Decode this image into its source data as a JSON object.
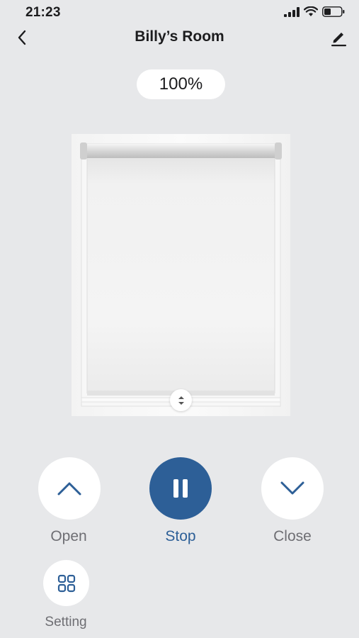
{
  "status_bar": {
    "time": "21:23"
  },
  "header": {
    "title": "Billy’s Room"
  },
  "position": {
    "label": "100%",
    "value_percent": 100
  },
  "controls": {
    "open_label": "Open",
    "stop_label": "Stop",
    "close_label": "Close",
    "setting_label": "Setting"
  },
  "icons": {
    "back": "chevron-left-icon",
    "edit": "pencil-icon",
    "open": "chevron-up-icon",
    "stop": "pause-icon",
    "close": "chevron-down-icon",
    "setting": "grid-icon",
    "drag": "up-down-arrows-icon"
  },
  "colors": {
    "accent": "#2d5f97",
    "background": "#e7e8ea",
    "label_gray": "#6e6e73"
  }
}
